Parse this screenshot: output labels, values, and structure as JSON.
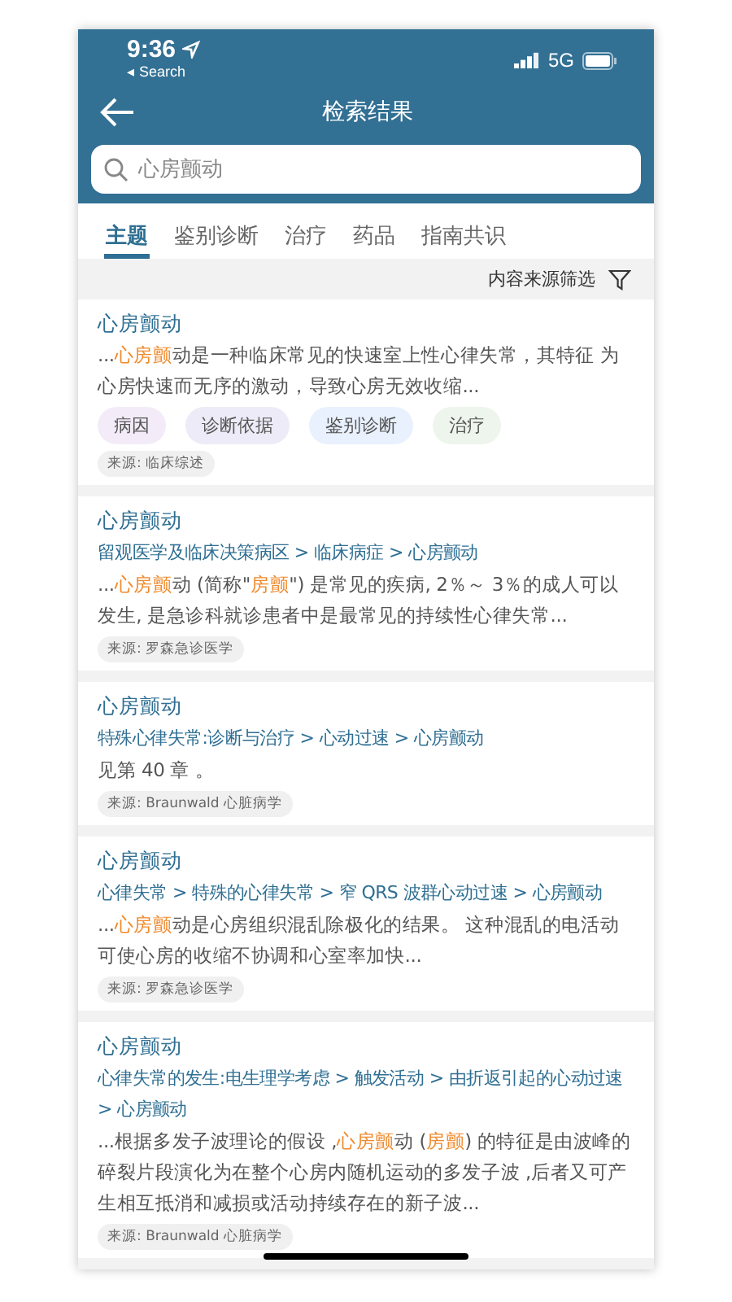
{
  "status_bar": {
    "time": "9:36",
    "back_label": "◂ Search",
    "network": "5G"
  },
  "header": {
    "title": "检索结果"
  },
  "search": {
    "value": "心房颤动"
  },
  "tabs": [
    {
      "label": "主题",
      "selected": true
    },
    {
      "label": "鉴别诊断",
      "selected": false
    },
    {
      "label": "治疗",
      "selected": false
    },
    {
      "label": "药品",
      "selected": false
    },
    {
      "label": "指南共识",
      "selected": false
    }
  ],
  "filter": {
    "label": "内容来源筛选"
  },
  "results": [
    {
      "title": "心房颤动",
      "snippet": [
        {
          "text": "...",
          "highlight": false
        },
        {
          "text": "心房颤",
          "highlight": true
        },
        {
          "text": "动是一种临床常见的快速室上性心律失常，其特征 为心房快速而无序的激动，导致心房无效收缩...",
          "highlight": false
        }
      ],
      "tags": [
        {
          "label": "病因",
          "color": "#f3ecf8"
        },
        {
          "label": "诊断依据",
          "color": "#ecebf7"
        },
        {
          "label": "鉴别诊断",
          "color": "#e8f1fd"
        },
        {
          "label": "治疗",
          "color": "#eef5ec"
        }
      ],
      "source": "来源: 临床综述"
    },
    {
      "title": "心房颤动",
      "path": "留观医学及临床决策病区 > 临床病症 > 心房颤动",
      "snippet": [
        {
          "text": "...",
          "highlight": false
        },
        {
          "text": "心房颤",
          "highlight": true
        },
        {
          "text": "动 (简称\"",
          "highlight": false
        },
        {
          "text": "房颤",
          "highlight": true
        },
        {
          "text": "\") 是常见的疾病, 2％～ 3％的成人可以发生, 是急诊科就诊患者中是最常见的持续性心律失常...",
          "highlight": false
        }
      ],
      "source": "来源: 罗森急诊医学"
    },
    {
      "title": "心房颤动",
      "path": "特殊心律失常:诊断与治疗 > 心动过速 > 心房颤动",
      "snippet": [
        {
          "text": "见第 40 章 。",
          "highlight": false
        }
      ],
      "source": "来源: Braunwald 心脏病学"
    },
    {
      "title": "心房颤动",
      "path": "心律失常 > 特殊的心律失常 > 窄 QRS 波群心动过速 > 心房颤动",
      "snippet": [
        {
          "text": "...",
          "highlight": false
        },
        {
          "text": "心房颤",
          "highlight": true
        },
        {
          "text": "动是心房组织混乱除极化的结果。 这种混乱的电活动可使心房的收缩不协调和心室率加快...",
          "highlight": false
        }
      ],
      "source": "来源: 罗森急诊医学"
    },
    {
      "title": "心房颤动",
      "path": "心律失常的发生:电生理学考虑 > 触发活动 > 由折返引起的心动过速 > 心房颤动",
      "snippet": [
        {
          "text": "...根据多发子波理论的假设 ,",
          "highlight": false
        },
        {
          "text": "心房颤",
          "highlight": true
        },
        {
          "text": "动 (",
          "highlight": false
        },
        {
          "text": "房颤",
          "highlight": true
        },
        {
          "text": ") 的特征是由波峰的碎裂片段演化为在整个心房内随机运动的多发子波 ,后者又可产生相互抵消和减损或活动持续存在的新子波...",
          "highlight": false
        }
      ],
      "source": "来源: Braunwald 心脏病学"
    }
  ]
}
